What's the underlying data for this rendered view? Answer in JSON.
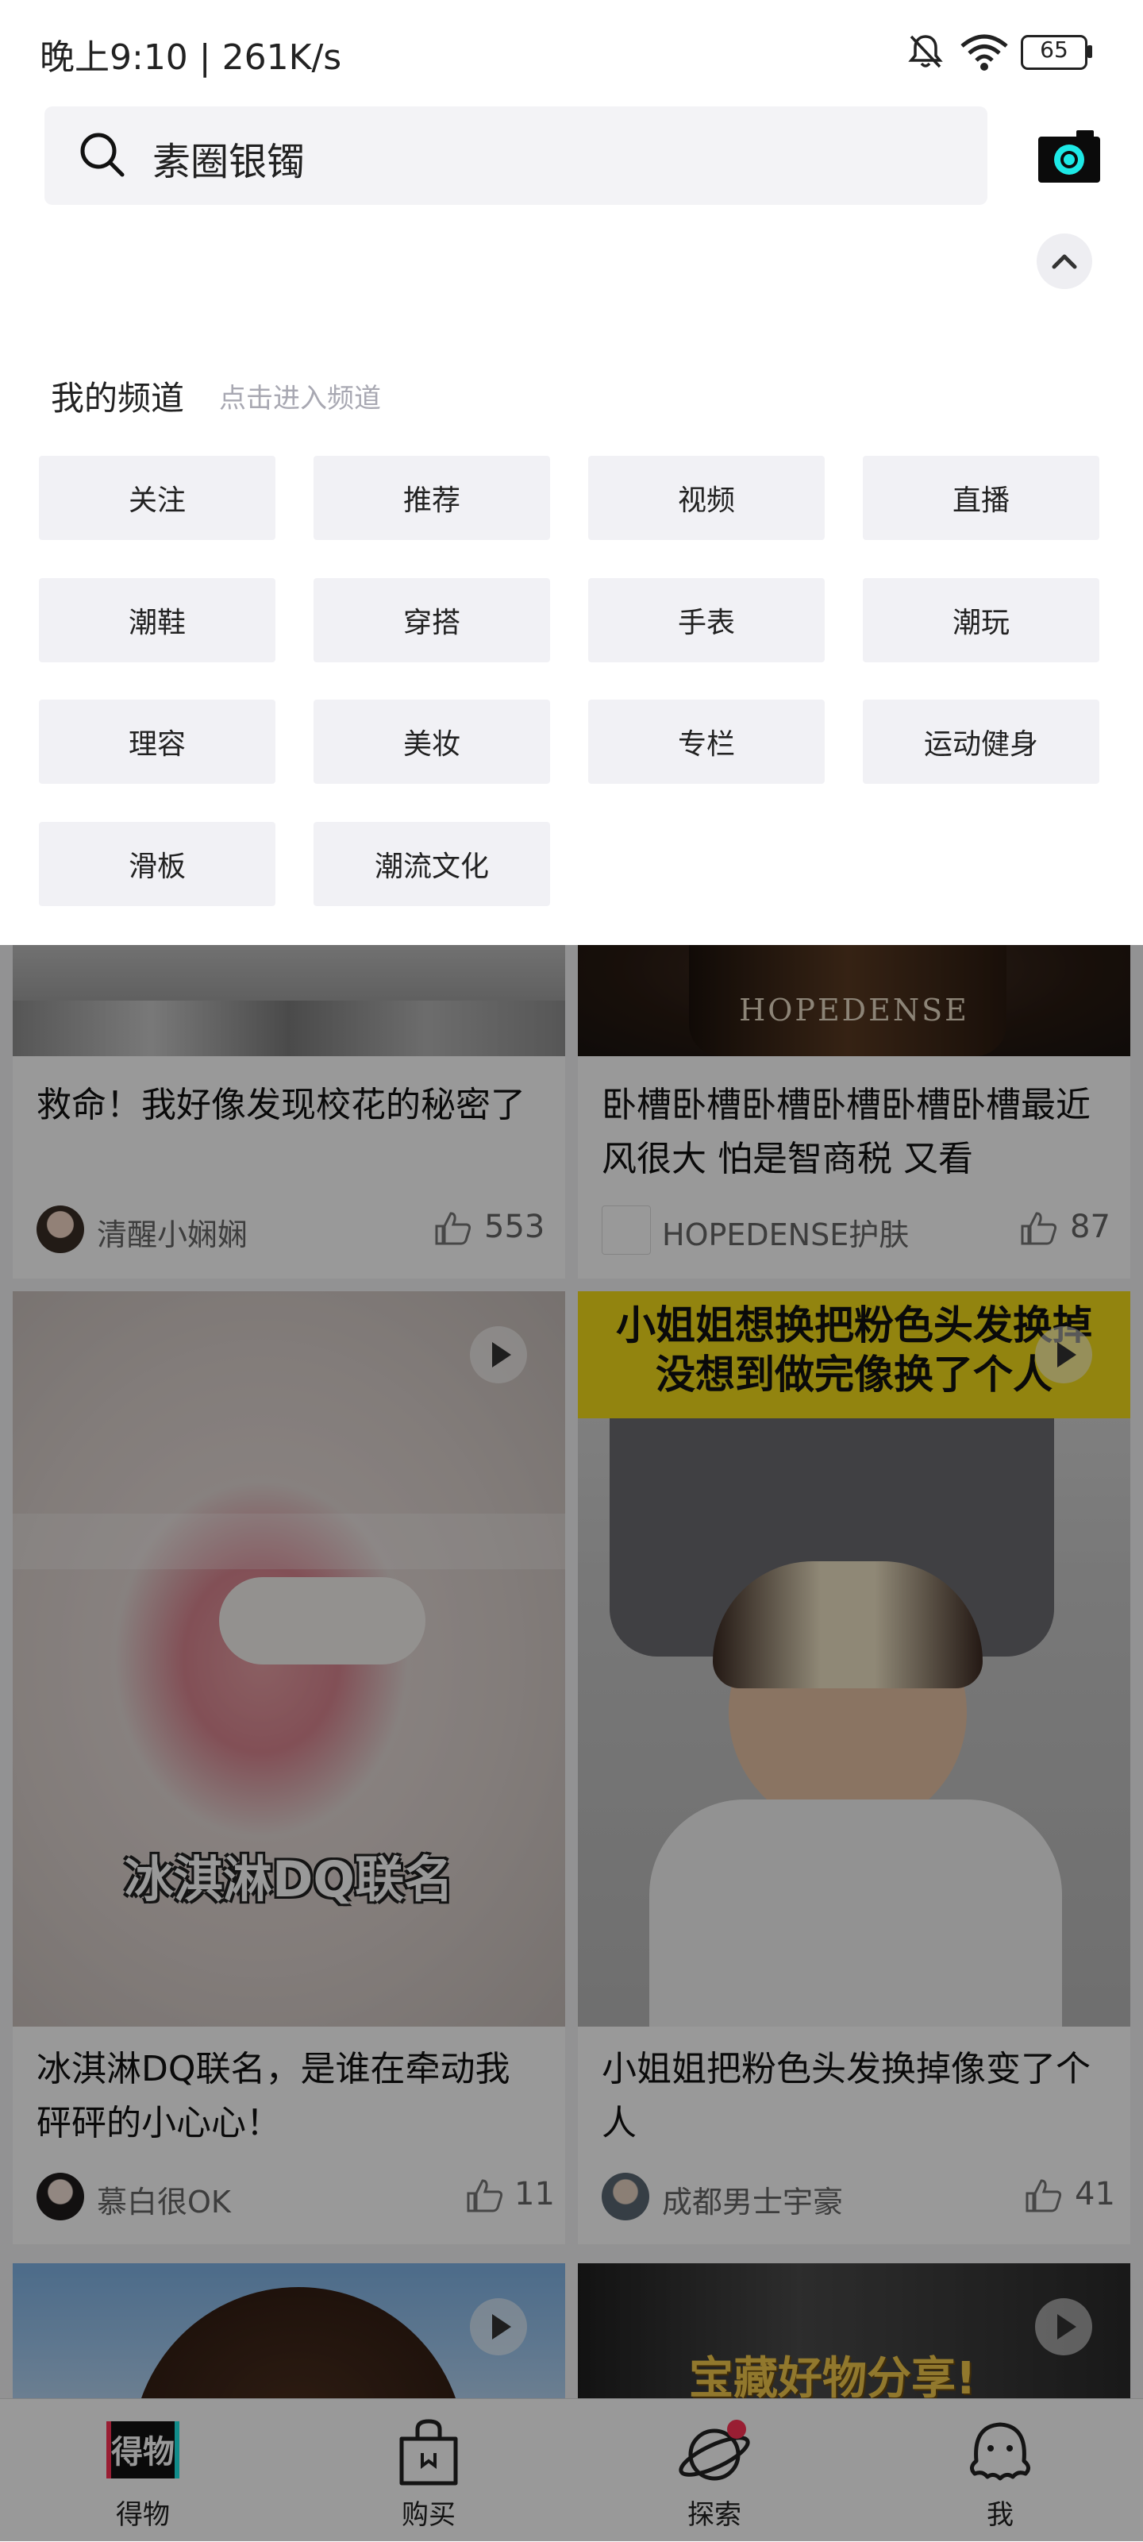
{
  "status_bar": {
    "time": "晚上9:10 | 261K/s",
    "battery": "65",
    "icons": [
      "bell-muted-icon",
      "wifi-icon",
      "battery-icon"
    ]
  },
  "search": {
    "query": "素圈银镯",
    "icon": "search-icon",
    "camera_icon": "camera-icon"
  },
  "collapse_icon": "chevron-up-icon",
  "channels": {
    "title": "我的频道",
    "hint": "点击进入频道",
    "items": [
      "关注",
      "推荐",
      "视频",
      "直播",
      "潮鞋",
      "穿搭",
      "手表",
      "潮玩",
      "理容",
      "美妆",
      "专栏",
      "运动健身",
      "滑板",
      "潮流文化"
    ]
  },
  "feed": {
    "posts": [
      {
        "title": "救命！我好像发现校花的秘密了",
        "author": "清醒小娴娴",
        "likes": "553"
      },
      {
        "title": "卧槽卧槽卧槽卧槽卧槽卧槽最近风很大 怕是智商税 又看",
        "author": "HOPEDENSE护肤",
        "likes": "87",
        "thumb_text": "HOPEDENSE"
      },
      {
        "title": "冰淇淋DQ联名，是谁在牵动我砰砰的小心心！",
        "author": "慕白很OK",
        "likes": "11",
        "overlay": "冰淇淋DQ联名"
      },
      {
        "title": "小姐姐把粉色头发换掉像变了个人",
        "author": "成都男士宇豪",
        "likes": "41",
        "banner_line1": "小姐姐想换把粉色头发换掉",
        "banner_line2": "没想到做完像换了个人"
      },
      {
        "title": "",
        "author": "",
        "likes": ""
      },
      {
        "title": "",
        "author": "",
        "likes": "",
        "overlay": "宝藏好物分享!"
      }
    ]
  },
  "tabbar": {
    "items": [
      {
        "label": "得物",
        "icon": "dewu-logo-icon"
      },
      {
        "label": "购买",
        "icon": "shopping-bag-icon"
      },
      {
        "label": "探索",
        "icon": "planet-icon"
      },
      {
        "label": "我",
        "icon": "profile-octopus-icon"
      }
    ],
    "colors": {
      "accent": "#ff3355",
      "dim_overlay": "rgba(0,0,0,0.40)",
      "camera_accent": "#1de9e6"
    }
  }
}
